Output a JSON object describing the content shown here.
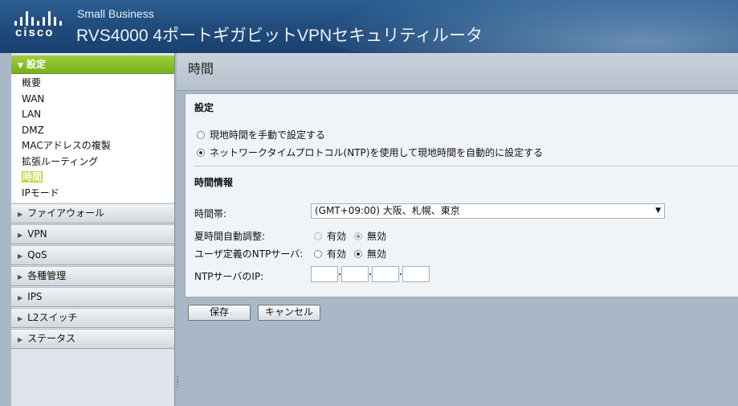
{
  "header": {
    "logo_text": "cisco",
    "brand_small": "Small Business",
    "title": "RVS4000 4ポートギガビットVPNセキュリティルータ"
  },
  "sidebar": {
    "open_section": "設定",
    "sub_items": [
      {
        "label": "概要",
        "active": false
      },
      {
        "label": "WAN",
        "active": false
      },
      {
        "label": "LAN",
        "active": false
      },
      {
        "label": "DMZ",
        "active": false
      },
      {
        "label": "MACアドレスの複製",
        "active": false
      },
      {
        "label": "拡張ルーティング",
        "active": false
      },
      {
        "label": "時間",
        "active": true
      },
      {
        "label": "IPモード",
        "active": false
      }
    ],
    "groups": [
      "ファイアウォール",
      "VPN",
      "QoS",
      "各種管理",
      "IPS",
      "L2スイッチ",
      "ステータス"
    ]
  },
  "main": {
    "page_title": "時間",
    "settings": {
      "heading": "設定",
      "option_manual": "現地時間を手動で設定する",
      "option_ntp": "ネットワークタイムプロトコル(NTP)を使用して現地時間を自動的に設定する",
      "selected": "ntp"
    },
    "time_info": {
      "heading": "時間情報",
      "timezone_label": "時間帯:",
      "timezone_value": "(GMT+09:00) 大阪、札幌、東京",
      "dst_label": "夏時間自動調整:",
      "dst_enable": "有効",
      "dst_disable": "無効",
      "dst_selected": "disable",
      "user_ntp_label": "ユーザ定義のNTPサーバ:",
      "user_ntp_enable": "有効",
      "user_ntp_disable": "無効",
      "user_ntp_selected": "disable",
      "ntp_ip_label": "NTPサーバのIP:",
      "ntp_ip_octets": [
        "",
        "",
        "",
        ""
      ]
    },
    "buttons": {
      "save": "保存",
      "cancel": "キャンセル"
    }
  }
}
